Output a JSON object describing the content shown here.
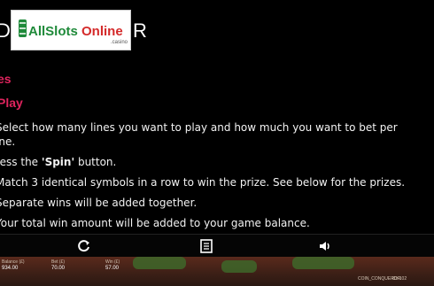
{
  "header": {
    "title_fragment_left": "D",
    "title_fragment_right": "R"
  },
  "logo": {
    "brand": "AllSlotsOnline",
    "suffix": ".casino"
  },
  "section": {
    "title": "es",
    "subtitle": "Play"
  },
  "rules": [
    "Select how many lines you want to play and how much you want to bet per line.",
    "Press the 'Spin' button.",
    "Match 3 identical symbols in a row to win the prize. See below for the prizes.",
    "Separate wins will be added together.",
    "Your total win amount will be added to your game balance."
  ],
  "rules_display": {
    "r0a": "Select how many lines you want to play and how much you want to bet per",
    "r0b": "ine.",
    "r1_pre": "ress the ",
    "r1_bold": "'Spin'",
    "r1_post": " button.",
    "r2": "Match 3 identical symbols in a row to win the prize. See below for the prizes.",
    "r3": "Separate wins will be added together.",
    "r4": "Your total win amount will be added to your game balance."
  },
  "toolbar": {
    "icons": [
      "reload-icon",
      "paytable-icon",
      "volume-icon"
    ]
  },
  "footer": {
    "balance_label": "Balance (£)",
    "balance_value": "934.00",
    "bet_label": "Bet (£)",
    "bet_value": "70.00",
    "win_label": "Win (£)",
    "win_value": "57.00",
    "game_name": "COIN_CONQUEROR",
    "game_id": "ID: 102"
  },
  "colors": {
    "accent": "#e0245e",
    "logo_green": "#1f8a3a",
    "logo_red": "#d42a2a"
  }
}
